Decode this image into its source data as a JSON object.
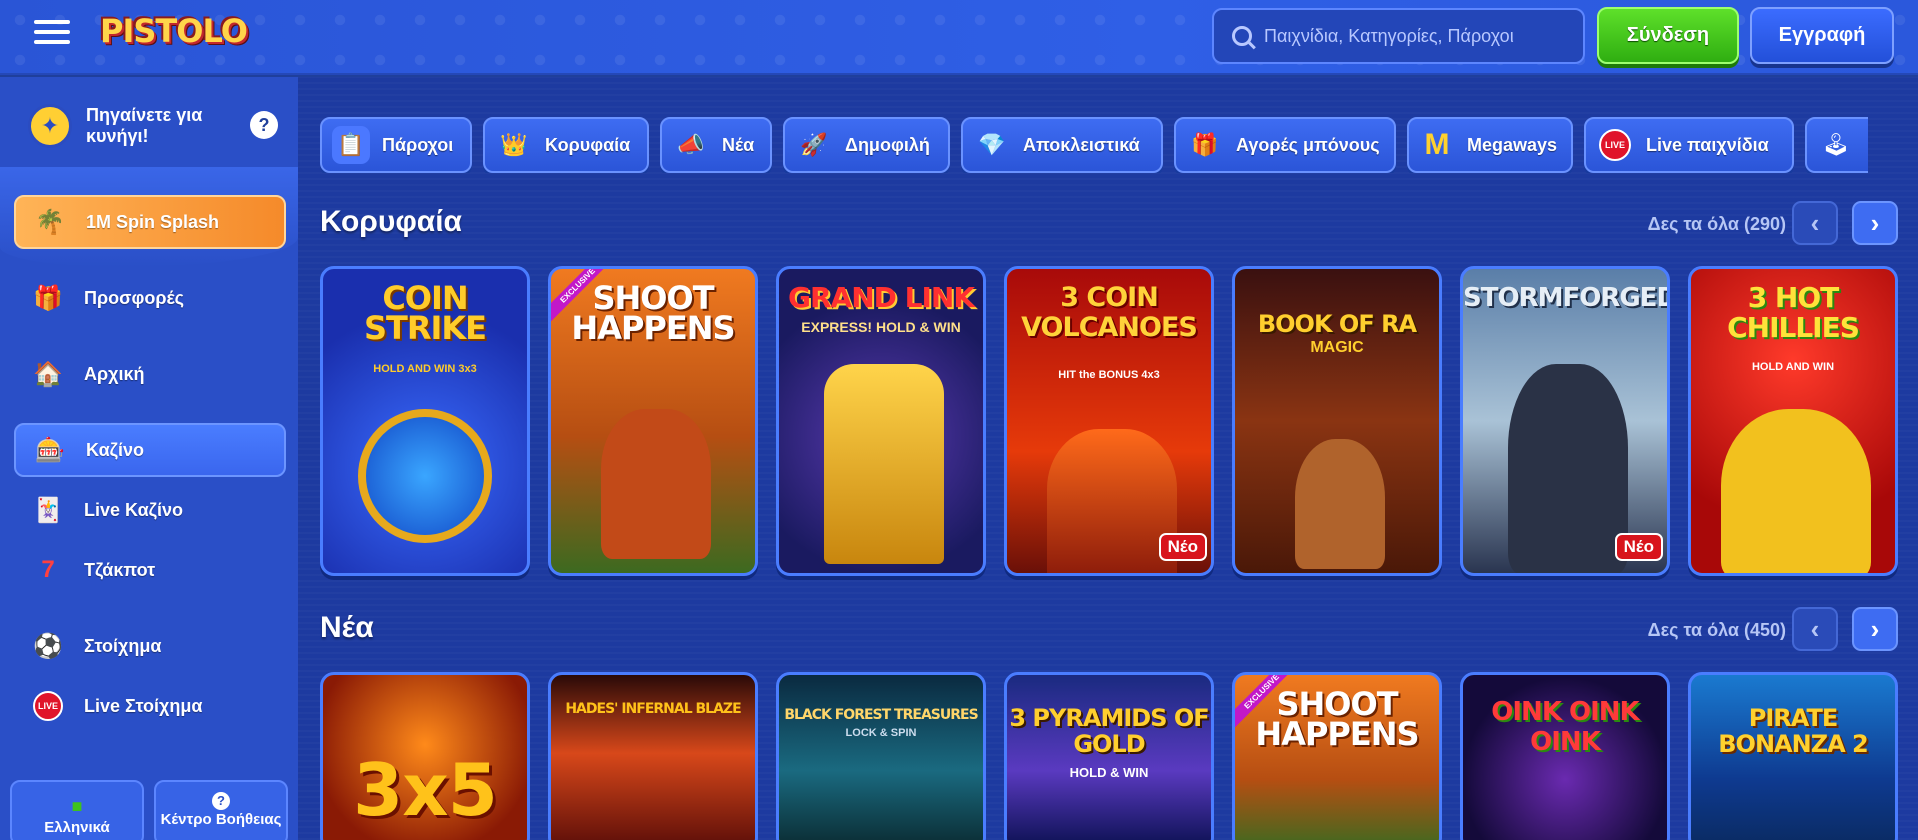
{
  "header": {
    "logo_text": "PISTOLO",
    "search_placeholder": "Παιχνίδια, Κατηγορίες, Πάροχοι",
    "login_label": "Σύνδεση",
    "register_label": "Εγγραφή"
  },
  "sidebar": {
    "hunt_label": "Πηγαίνετε για κυνήγι!",
    "help_glyph": "?",
    "items": [
      {
        "label": "1M Spin Splash",
        "icon": "palm-island-icon"
      },
      {
        "label": "Προσφορές",
        "icon": "gift-icon"
      },
      {
        "label": "Αρχική",
        "icon": "home-icon"
      },
      {
        "label": "Καζίνο",
        "icon": "slot-777-icon"
      },
      {
        "label": "Live Καζίνο",
        "icon": "cards-chip-icon"
      },
      {
        "label": "Τζάκποτ",
        "icon": "jackpot-7-icon"
      },
      {
        "label": "Στοίχημα",
        "icon": "football-icon"
      },
      {
        "label": "Live Στοίχημα",
        "icon": "live-badge-icon"
      }
    ],
    "language_label": "Ελληνικά",
    "help_center_label": "Κέντρο Βοήθειας"
  },
  "categories": [
    {
      "label": "Πάροχοι",
      "icon": "notepad-icon"
    },
    {
      "label": "Κορυφαία",
      "icon": "crown-gem-icon"
    },
    {
      "label": "Νέα",
      "icon": "megaphone-icon"
    },
    {
      "label": "Δημοφιλή",
      "icon": "rocket-icon"
    },
    {
      "label": "Αποκλειστικά",
      "icon": "diamond-icon"
    },
    {
      "label": "Αγορές μπόνους",
      "icon": "gift-box-icon"
    },
    {
      "label": "Megaways",
      "icon": "m-letter-icon"
    },
    {
      "label": "Live παιχνίδια",
      "icon": "live-icon"
    }
  ],
  "sections": {
    "top": {
      "title": "Κορυφαία",
      "see_all": "Δες τα όλα (290)",
      "games": [
        {
          "title": "COIN STRIKE",
          "subtitle": "HOLD AND WIN 3x3",
          "badge": "",
          "exclusive": ""
        },
        {
          "title": "SHOOT HAPPENS",
          "subtitle": "",
          "badge": "",
          "exclusive": "EXCLUSIVE"
        },
        {
          "title": "GRAND LINK",
          "subtitle": "EXPRESS! HOLD & WIN",
          "badge": "",
          "exclusive": ""
        },
        {
          "title": "3 COIN VOLCANOES",
          "subtitle": "HIT the BONUS 4x3",
          "badge": "Νέο",
          "exclusive": ""
        },
        {
          "title": "BOOK OF RA",
          "subtitle": "MAGIC",
          "badge": "",
          "exclusive": ""
        },
        {
          "title": "STORMFORGED",
          "subtitle": "",
          "badge": "Νέο",
          "exclusive": ""
        },
        {
          "title": "3 HOT CHILLIES",
          "subtitle": "HOLD AND WIN",
          "badge": "",
          "exclusive": ""
        }
      ]
    },
    "new": {
      "title": "Νέα",
      "see_all": "Δες τα όλα (450)",
      "games": [
        {
          "title": "3x5",
          "subtitle": "",
          "exclusive": ""
        },
        {
          "title": "HADES' INFERNAL BLAZE",
          "subtitle": "",
          "exclusive": ""
        },
        {
          "title": "BLACK FOREST TREASURES",
          "subtitle": "LOCK & SPIN",
          "exclusive": ""
        },
        {
          "title": "3 PYRAMIDS OF GOLD",
          "subtitle": "HOLD & WIN",
          "exclusive": ""
        },
        {
          "title": "SHOOT HAPPENS",
          "subtitle": "",
          "exclusive": "EXCLUSIVE"
        },
        {
          "title": "OINK OINK OINK",
          "subtitle": "",
          "exclusive": ""
        },
        {
          "title": "PIRATE BONANZA 2",
          "subtitle": "",
          "exclusive": ""
        }
      ]
    }
  },
  "nav": {
    "prev": "‹",
    "next": "›"
  },
  "colors": {
    "accent_green": "#3fc31c",
    "accent_blue": "#3e6cf2",
    "badge_red": "#d8141c",
    "promo_orange": "#f89a3a"
  }
}
